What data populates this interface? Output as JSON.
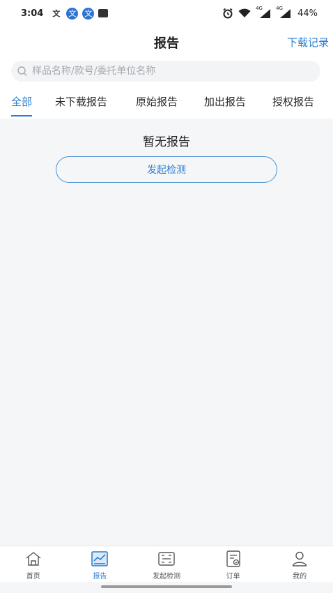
{
  "status_bar": {
    "time": "3:04",
    "app_icons": [
      "文",
      "文",
      "文"
    ],
    "battery": "44%",
    "signal_labels": [
      "4G",
      "4G"
    ]
  },
  "header": {
    "title": "报告",
    "download_history": "下载记录"
  },
  "search": {
    "placeholder": "样品名称/款号/委托单位名称",
    "value": ""
  },
  "tabs": [
    {
      "label": "全部",
      "active": true
    },
    {
      "label": "未下载报告",
      "active": false
    },
    {
      "label": "原始报告",
      "active": false
    },
    {
      "label": "加出报告",
      "active": false
    },
    {
      "label": "授权报告",
      "active": false
    }
  ],
  "empty_state": {
    "message": "暂无报告",
    "button": "发起检测"
  },
  "bottom_nav": [
    {
      "label": "首页",
      "icon": "home-icon",
      "active": false
    },
    {
      "label": "报告",
      "icon": "report-icon",
      "active": true
    },
    {
      "label": "发起检测",
      "icon": "scan-icon",
      "active": false
    },
    {
      "label": "订单",
      "icon": "order-icon",
      "active": false
    },
    {
      "label": "我的",
      "icon": "profile-icon",
      "active": false
    }
  ],
  "colors": {
    "accent": "#2b7fd4",
    "background": "#f5f6f8"
  }
}
